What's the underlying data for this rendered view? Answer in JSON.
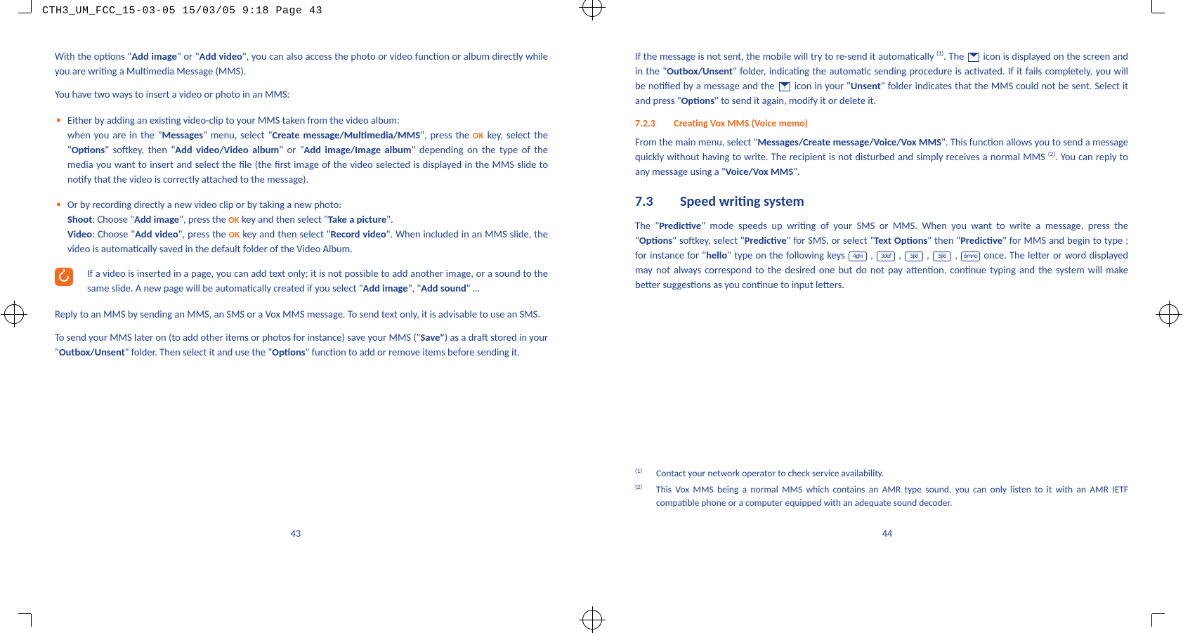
{
  "header_line": "CTH3_UM_FCC_15-03-05  15/03/05  9:18  Page 43",
  "left": {
    "p1_a": "With the options \"",
    "p1_b": "Add image",
    "p1_c": "\" or \"",
    "p1_d": "Add video",
    "p1_e": "\", you can also access the photo or video function or album directly while you are writing a Multimedia Message (MMS).",
    "p2": "You have two ways to insert a video or photo in an MMS:",
    "li1_a": "Either by adding an existing video-clip to your MMS taken from the video album:",
    "li1_b": "when you are in the \"",
    "li1_c": "Messages",
    "li1_d": "\" menu, select \"",
    "li1_e": "Create message/Multimedia/MMS",
    "li1_f": "\", press the ",
    "li1_g": " key, select the \"",
    "li1_h": "Options",
    "li1_i": "\" softkey, then \"",
    "li1_j": "Add video/Video album",
    "li1_k": "\" or \"",
    "li1_l": "Add image/Image album",
    "li1_m": "\" depending on the type of the media you want to insert and select the file (the first image of the video selected is displayed in the MMS slide to notify that the video is correctly attached to the message).",
    "li2_a": "Or by recording directly a new video clip or by taking a new photo:",
    "li2_b": "Shoot",
    "li2_c": ": Choose \"",
    "li2_d": "Add image",
    "li2_e": "\", press the ",
    "li2_f": " key and then select \"",
    "li2_g": "Take a picture",
    "li2_h": "\".",
    "li2_i": "Video",
    "li2_j": ": Choose \"",
    "li2_k": "Add video",
    "li2_l": "\", press the ",
    "li2_m": " key and then select \"",
    "li2_n": "Record video",
    "li2_o": "\". When included in an MMS slide, the video is automatically saved in the default folder of the Video Album.",
    "tip_a": "If a video is inserted in a page, you can add text only; it is not possible to add another image, or a sound to the same slide. A new page will be automatically created if you select \"",
    "tip_b": "Add image",
    "tip_c": "\", \"",
    "tip_d": "Add sound",
    "tip_e": "\" …",
    "p3": "Reply to an MMS by sending an MMS, an SMS or a Vox MMS message. To send text only, it is advisable to use an SMS.",
    "p4_a": "To send your MMS later on (to add other items or photos for instance) save your MMS (\"",
    "p4_b": "Save\"",
    "p4_c": ") as a draft stored in your \"",
    "p4_d": "Outbox/Unsent",
    "p4_e": "\" folder. Then select it and use the \"",
    "p4_f": "Options",
    "p4_g": "\" function to add or remove items before sending it.",
    "pagenum": "43"
  },
  "right": {
    "p1_a": "If the message is not sent, the mobile will try to re-send it automatically ",
    "p1_b": ". The ",
    "p1_c": " icon is displayed on the screen and in the \"",
    "p1_d": "Outbox/Unsent",
    "p1_e": "\" folder, indicating the automatic sending procedure is activated. If it fails completely, you will be notified by a message and the ",
    "p1_f": " icon in your \"",
    "p1_g": "Unsent",
    "p1_h": "\" folder indicates that the MMS could not be sent. Select it and press \"",
    "p1_i": "Options",
    "p1_j": "\" to send it again, modify it or delete it.",
    "sec723_no": "7.2.3",
    "sec723_t": "Creating Vox MMS (Voice memo)",
    "p2_a": "From the main menu, select \"",
    "p2_b": "Messages/Create message/Voice/Vox MMS",
    "p2_c": "\". This function allows you to send a message quickly without having to write. The recipient is not disturbed and simply receives a normal MMS ",
    "p2_d": ". You can reply to any message using a \"",
    "p2_e": "Voice/Vox MMS",
    "p2_f": "\".",
    "h73_no": "7.3",
    "h73_t": "Speed writing system",
    "p3_a": "The \"",
    "p3_b": "Predictive",
    "p3_c": "\" mode speeds up writing of your SMS or MMS. When you want to write a message, press the \"",
    "p3_d": "Options",
    "p3_e": "\" softkey, select \"",
    "p3_f": "Predictive",
    "p3_g": "\" for SMS, or select \"",
    "p3_h": "Text Options",
    "p3_i": "\" then \"",
    "p3_j": "Predictive",
    "p3_k": "\" for MMS and begin to type ; for instance for \"",
    "p3_l": "hello",
    "p3_m": "\" type on the following keys ",
    "p3_n": " once. The letter or word displayed may not always correspond to the desired one but do not pay attention, continue typing and the system will make better suggestions as you continue to input letters.",
    "key1": "4ghi",
    "key2": "3def",
    "key3": "5jkl",
    "key4": "5jkl",
    "key5": "6mno",
    "fn1_m": "(1)",
    "fn1_t": "Contact your network operator to check service availability.",
    "fn2_m": "(2)",
    "fn2_t": "This Vox MMS being a normal MMS which contains an AMR type sound, you can only listen to it with an AMR IETF compatible phone or a computer equipped with an adequate sound decoder.",
    "pagenum": "44"
  },
  "ok_label": "OK",
  "sup1": "(1)",
  "sup2": "(2)",
  "comma": " , "
}
